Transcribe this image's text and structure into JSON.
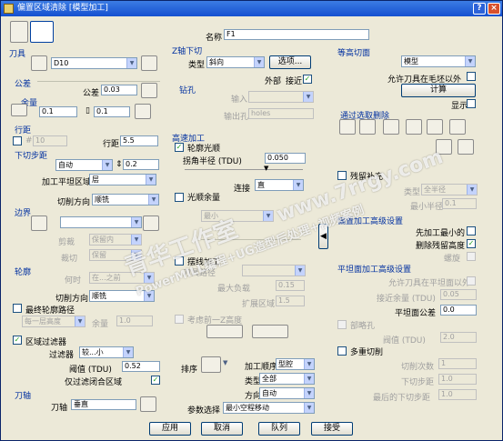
{
  "title": "偏置区域清除 [模型加工]",
  "name": {
    "label": "名称",
    "value": "F1"
  },
  "tool": {
    "header": "刀具",
    "value": "D10"
  },
  "tolerance": {
    "header": "公差",
    "label": "公差",
    "value": "0.03"
  },
  "allowance": {
    "header": "余量",
    "v1": "0.1",
    "v2": "0.1"
  },
  "stepover": {
    "header": "行距",
    "num_label": "#",
    "num_value": "10",
    "label": "行距",
    "value": "5.5"
  },
  "stepdown": {
    "header": "下切步距",
    "mode": "自动",
    "value": "0.2",
    "flat_label": "加工平坦区域",
    "flat_value": "层",
    "dir_label": "切削方向",
    "dir_value": "顺铣"
  },
  "boundary": {
    "header": "边界",
    "trim_label": "剪裁",
    "trim_value": "保留内",
    "cut_label": "裁切",
    "cut_value": "保留"
  },
  "profile": {
    "header": "轮廓",
    "when_label": "何时",
    "when_value": "在...之前",
    "dir_label": "切削方向",
    "dir_value": "顺铣",
    "final_label": "最终轮廓路径",
    "each_value": "每一层高度",
    "allow_label": "余量",
    "allow_value": "1.0"
  },
  "area_filter": {
    "label": "区域过滤器",
    "filter_label": "过滤器",
    "filter_value": "较...小",
    "threshold_label": "阈值 (TDU)",
    "threshold_value": "0.52",
    "closed_label": "仅过滤闭合区域"
  },
  "toolaxis": {
    "header": "刀轴",
    "label": "刀轴",
    "value": "垂直"
  },
  "zcut": {
    "header": "Z轴下切",
    "type_label": "类型",
    "type_value": "斜向",
    "options_label": "选项...",
    "ext_label": "外部",
    "approach_label": "接近"
  },
  "drill": {
    "header": "钻孔",
    "input_label": "输入",
    "output_label": "输出孔",
    "output_value": "holes"
  },
  "hsm": {
    "header": "高速加工",
    "smooth_label": "轮廓光顺",
    "radius_label": "拐角半径 (TDU)",
    "radius_value": "0.050",
    "link_label": "连接",
    "link_value": "直",
    "raster_label": "光顺余量",
    "raster_value": "最小",
    "trochoid_label": "摆线加工",
    "tool_path_label": "刀具路径",
    "max_load_label": "最大负载",
    "max_load_value": "0.15",
    "extend_label": "扩展区域",
    "extend_value": "1.5",
    "prev_label": "考虑前一Z高度"
  },
  "sort": {
    "label": "排序",
    "order_label": "加工顺序",
    "order_value": "型腔",
    "type_label": "类型",
    "type_value": "全部",
    "dir_label": "方向",
    "dir_value": "自动",
    "param_label": "参数选择",
    "param_value": "最小空程移动"
  },
  "flat": {
    "header": "等高切面",
    "type_value": "模型",
    "allow_outside_label": "允许刀具在毛坯以外",
    "calc_label": "计算",
    "show_label": "显示"
  },
  "select_delete": {
    "header": "通过选取删除"
  },
  "rest": {
    "header": "残留补充",
    "type_label": "类型",
    "type_value": "全半径",
    "min_r_label": "最小半径",
    "min_r_value": "0.1"
  },
  "offset_adv": {
    "header": "偏置加工高级设置",
    "first_label": "先加工最小的",
    "remove_label": "删除残留高度",
    "spiral_label": "螺旋"
  },
  "flat_adv": {
    "header": "平坦面加工高级设置",
    "allow_label": "允许刀具在平坦面以外",
    "tol_label": "接近余量 (TDU)",
    "tol_value": "0.05",
    "flat_tol_label": "平坦面公差",
    "flat_tol_value": "0.0",
    "undercut_label": "部略孔",
    "thresh_label": "阀值 (TDU)",
    "thresh_value": "2.0"
  },
  "multi": {
    "header": "多重切削",
    "count_label": "切削次数",
    "count_value": "1",
    "step_label": "下切步距",
    "step_value": "1.0",
    "last_label": "最后的下切步距",
    "last_value": "1.0"
  },
  "footer": {
    "apply": "应用",
    "cancel": "取消",
    "queue": "队列",
    "submit": "接受"
  },
  "watermark": {
    "line1": "青华工作室",
    "line2": "PowerMILL编程+UG造型后处理+视频案例",
    "url": "www.7rrgy.com"
  }
}
